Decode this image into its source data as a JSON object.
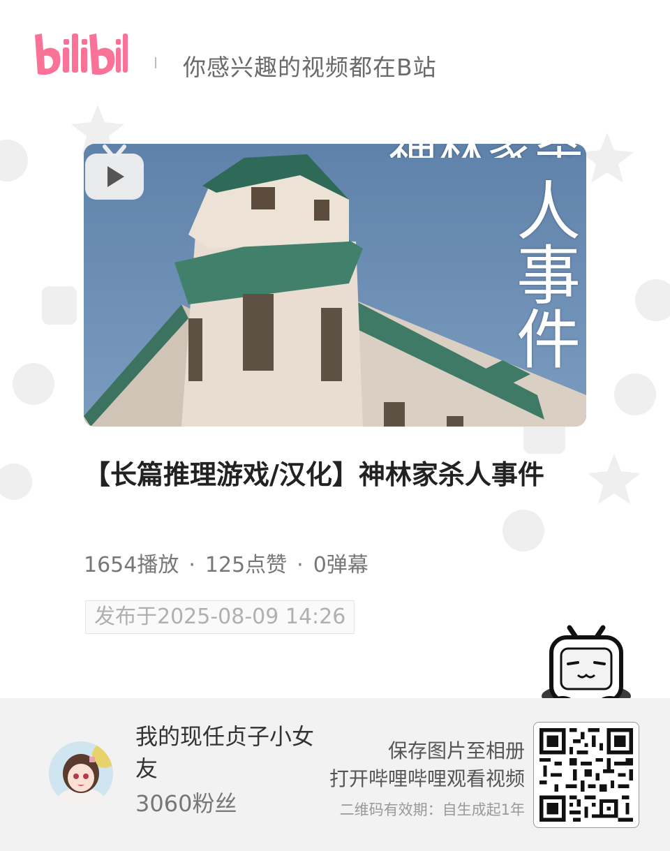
{
  "header": {
    "logo_text": "bilibili",
    "slogan": "你感兴趣的视频都在B站"
  },
  "video": {
    "cover_text_top": "神林家杀",
    "cover_text_col": [
      "人",
      "事",
      "件"
    ],
    "title": "【长篇推理游戏/汉化】神林家杀人事件",
    "stats": {
      "plays": "1654播放",
      "likes": "125点赞",
      "danmaku": "0弹幕",
      "separator": "·"
    },
    "publish_time": "发布于2025-08-09 14:26"
  },
  "footer": {
    "uploader_name": "我的现任贞子小女友",
    "fans": "3060粉丝",
    "cta_line1": "保存图片至相册",
    "cta_line2": "打开哔哩哔哩观看视频",
    "cta_note": "二维码有效期：自生成起1年"
  },
  "icons": {
    "logo": "bilibili-logo",
    "play": "tv-play-icon",
    "mascot": "bilibili-tv-mascot-icon",
    "qr": "qr-code"
  },
  "colors": {
    "brand_pink": "#fb7299",
    "background": "#ffffff",
    "footer_bg": "#f2f2f2",
    "sky_blue": "#6d8fb4"
  }
}
